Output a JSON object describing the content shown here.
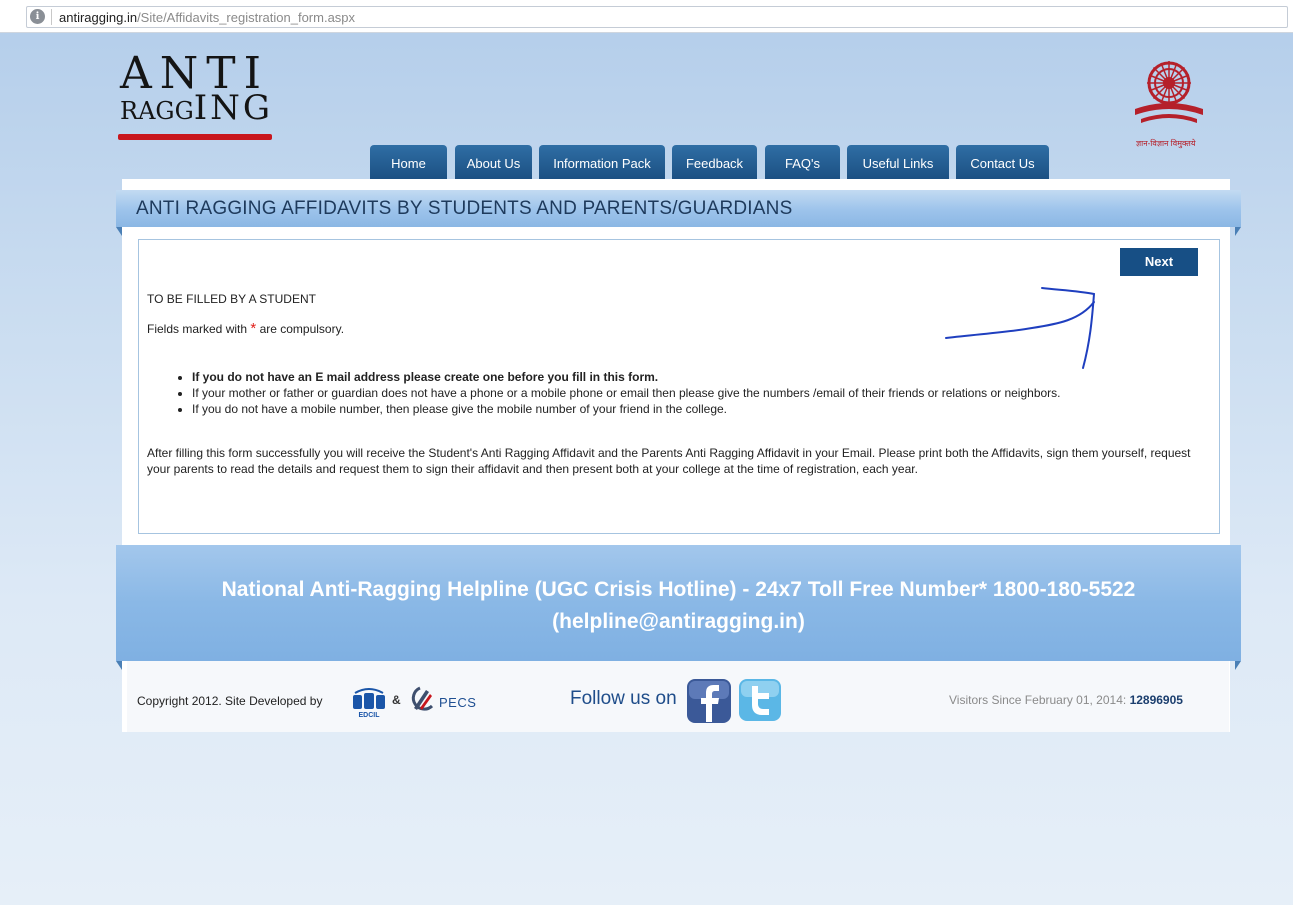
{
  "browser": {
    "url_domain": "antiragging.in",
    "url_path": "/Site/Affidavits_registration_form.aspx"
  },
  "header": {
    "logo_line1": "ANTI",
    "logo_line2_a": "RAGG",
    "logo_line2_b": "ING",
    "emblem_caption": "ज्ञान-विज्ञान विमुक्तये"
  },
  "nav": {
    "items": [
      {
        "label": "Home"
      },
      {
        "label": "About Us"
      },
      {
        "label": "Information Pack"
      },
      {
        "label": "Feedback"
      },
      {
        "label": "FAQ's"
      },
      {
        "label": "Useful Links"
      },
      {
        "label": "Contact Us"
      }
    ]
  },
  "page": {
    "title": "ANTI RAGGING AFFIDAVITS BY STUDENTS AND PARENTS/GUARDIANS",
    "next_label": "Next",
    "student_heading": "TO BE FILLED BY A STUDENT",
    "fields_note_prefix": "Fields marked with",
    "required_mark": "*",
    "fields_note_suffix": "are compulsory.",
    "bullets": [
      "If you do not have an E mail address please create one before you fill in this form.",
      "If your mother or father or guardian does not have a phone or a mobile phone or email then please give the numbers /email of their friends or relations or neighbors.",
      "If you do not have a mobile number, then please give the mobile number of your friend in the college."
    ],
    "paragraph": "After filling this form successfully you will receive the Student's Anti Ragging Affidavit and the Parents Anti Ragging Affidavit in your Email. Please print both the Affidavits, sign them yourself, request your parents to read the details and request them to sign their affidavit and then present both at your college at the time of registration, each year."
  },
  "helpline": {
    "line1": "National Anti-Ragging Helpline (UGC Crisis Hotline) - 24x7 Toll Free Number* 1800-180-5522",
    "line2": "(helpline@antiragging.in)"
  },
  "footer": {
    "copyright": "Copyright 2012. Site Developed by",
    "amp": "&",
    "edcil_label": "EDCIL",
    "pecs_label": "PECS",
    "follow_label": "Follow us on",
    "visitors_label": "Visitors Since February 01, 2014:",
    "visitors_count": "12896905"
  },
  "colors": {
    "nav_blue": "#1b4f82",
    "button_blue": "#174f85",
    "logo_red": "#c8161d",
    "required_red": "#e0201a",
    "facebook": "#3b5998",
    "twitter": "#5bb7e6",
    "annotation_ink": "#1f3fbf"
  },
  "icons": [
    "globe-icon",
    "emblem-icon",
    "edcil-icon",
    "pecs-icon",
    "facebook-icon",
    "twitter-icon"
  ]
}
